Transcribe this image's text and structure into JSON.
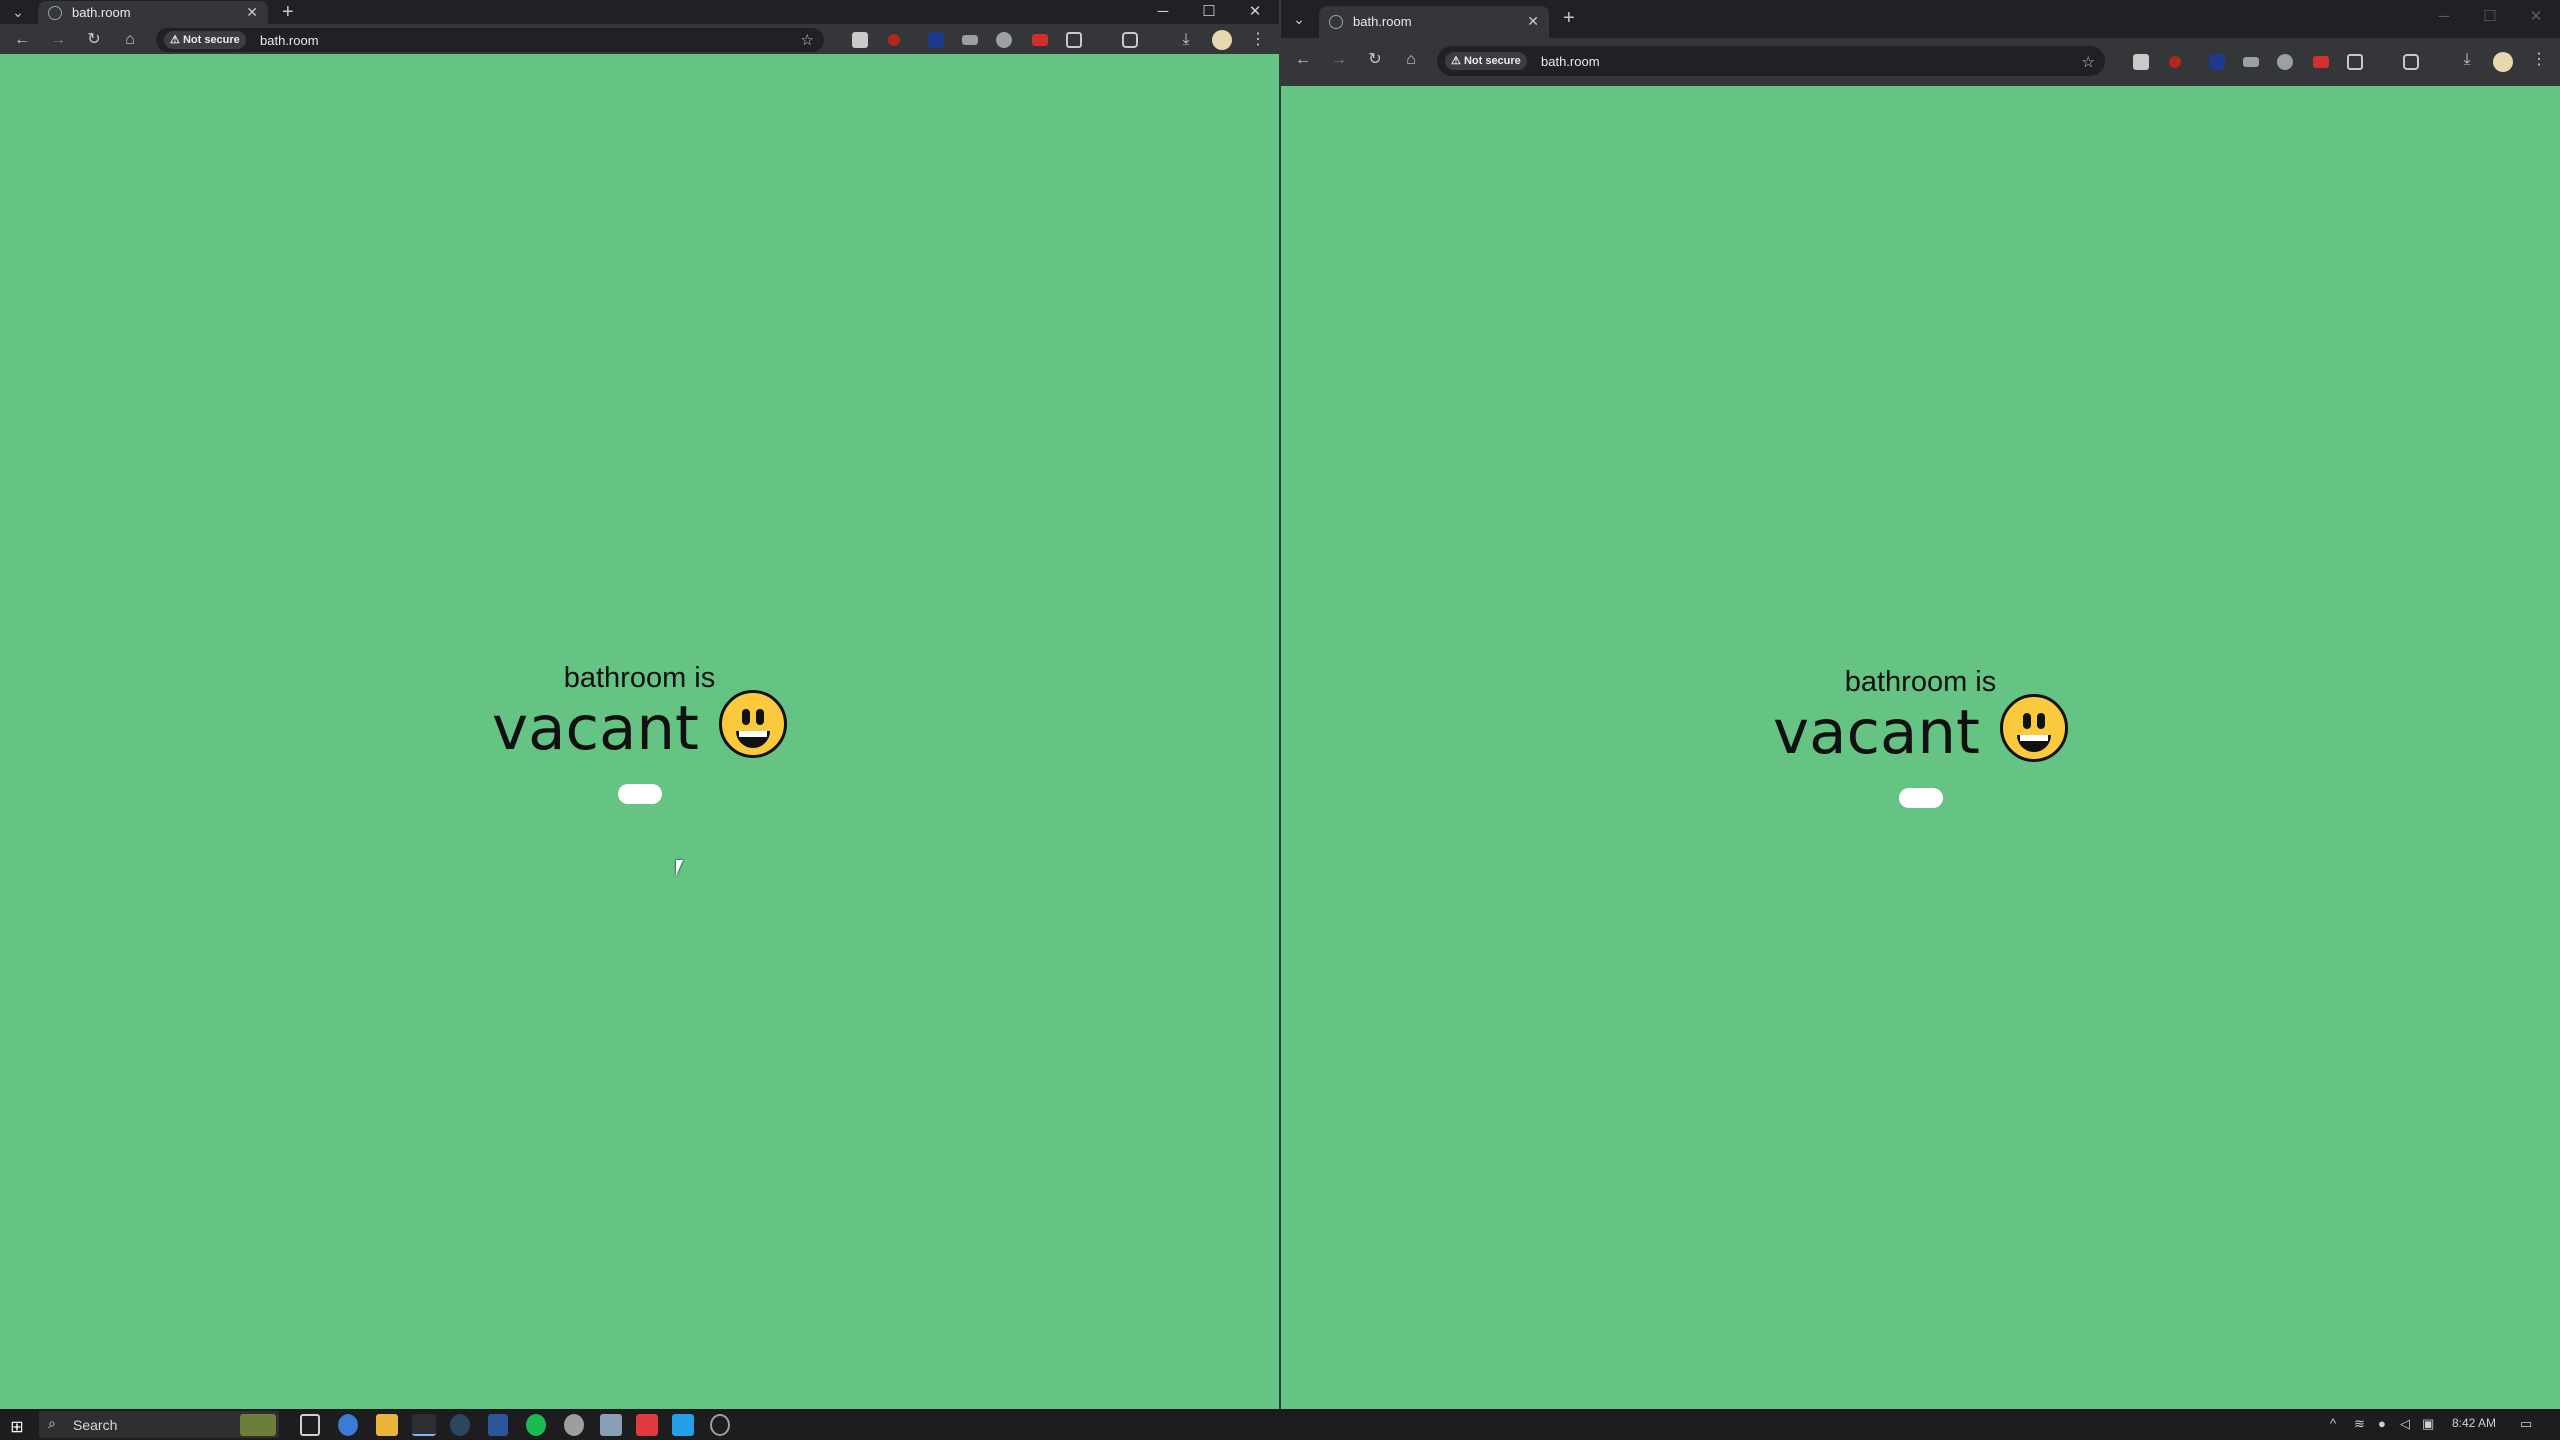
{
  "windows": [
    {
      "tab_title": "bath.room",
      "security_label": "Not secure",
      "url": "bath.room",
      "line1": "bathroom is",
      "status_word": "vacant",
      "window_controls": [
        "─",
        "☐",
        "✕"
      ]
    },
    {
      "tab_title": "bath.room",
      "security_label": "Not secure",
      "url": "bath.room",
      "line1": "bathroom is",
      "status_word": "vacant",
      "window_controls": [
        "─",
        "☐",
        "✕"
      ]
    }
  ],
  "page": {
    "background": "#65c383",
    "emoji": "grinning-face",
    "toggle_state": "off"
  },
  "taskbar": {
    "search_placeholder": "Search",
    "clock": "8:42 AM",
    "pinned_apps": [
      "news-widget",
      "task-view",
      "edge",
      "file-explorer",
      "chrome",
      "steam",
      "word",
      "spotify",
      "settings",
      "remote-app",
      "red-app",
      "vscode",
      "clock-app"
    ]
  },
  "icons": {
    "tab_search": "⌄",
    "close": "✕",
    "new_tab": "+",
    "back": "←",
    "forward": "→",
    "reload": "↻",
    "home": "⌂",
    "star": "☆",
    "warning": "⚠",
    "download": "⤓",
    "menu": "⋮",
    "start": "⊞",
    "search": "⌕"
  }
}
